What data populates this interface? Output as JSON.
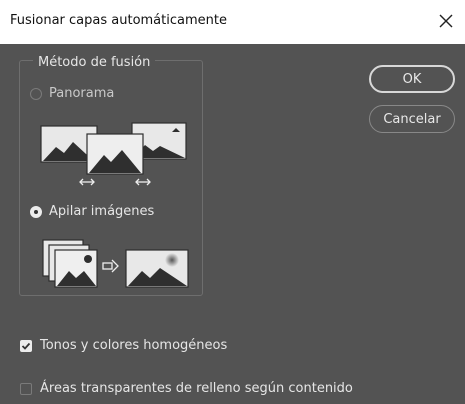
{
  "window": {
    "title": "Fusionar capas automáticamente",
    "close_icon": "close-icon"
  },
  "blend_method": {
    "legend": "Método de fusión",
    "options": [
      {
        "label": "Panorama",
        "selected": false,
        "icon": "panorama-illustration"
      },
      {
        "label": "Apilar imágenes",
        "selected": true,
        "icon": "stack-images-illustration"
      }
    ]
  },
  "buttons": {
    "ok": "OK",
    "cancel": "Cancelar"
  },
  "checkboxes": [
    {
      "label": "Tonos y colores homogéneos",
      "checked": true
    },
    {
      "label": "Áreas transparentes de relleno según contenido",
      "checked": false
    }
  ],
  "colors": {
    "background": "#535353",
    "titlebar": "#ffffff",
    "text": "#e6e6e6"
  }
}
